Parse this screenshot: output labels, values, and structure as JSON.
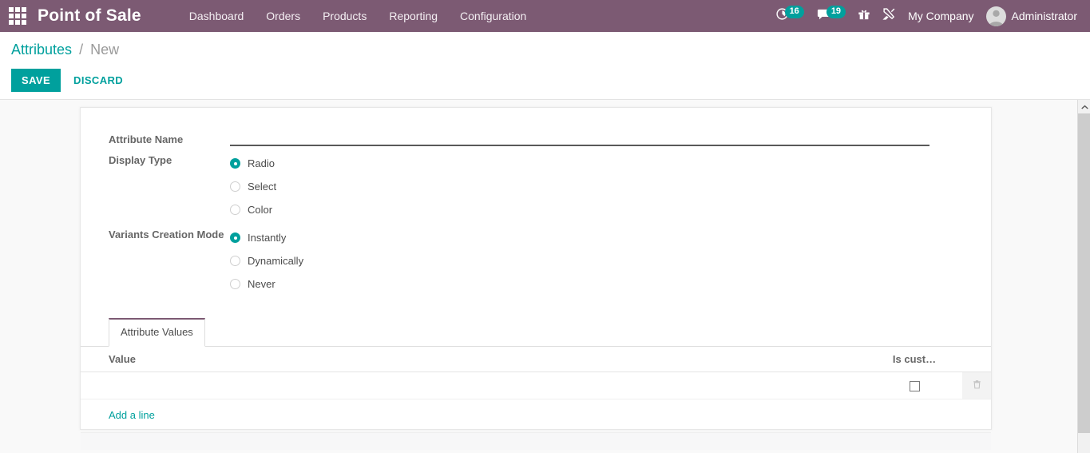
{
  "colors": {
    "navbar": "#7c5a73",
    "accent_teal": "#00a09d",
    "tab_active_border": "#7c5a73",
    "muted_text": "#9a9a9a"
  },
  "navbar": {
    "apps_icon": "apps-grid-icon",
    "brand": "Point of Sale",
    "menu": [
      {
        "label": "Dashboard"
      },
      {
        "label": "Orders"
      },
      {
        "label": "Products"
      },
      {
        "label": "Reporting"
      },
      {
        "label": "Configuration"
      }
    ],
    "systray": {
      "activity_icon": "clock-activity-icon",
      "activity_count": "16",
      "messages_icon": "chat-bubble-icon",
      "messages_count": "19",
      "gift_icon": "gift-icon",
      "tools_icon": "tools-icon",
      "company": "My Company",
      "avatar_icon": "user-avatar-icon",
      "user": "Administrator"
    }
  },
  "control_panel": {
    "breadcrumb": {
      "parent": "Attributes",
      "separator": "/",
      "current": "New"
    },
    "save_label": "SAVE",
    "discard_label": "DISCARD"
  },
  "form": {
    "attribute_name": {
      "label": "Attribute Name",
      "value": "",
      "placeholder": ""
    },
    "display_type": {
      "label": "Display Type",
      "selected": "Radio",
      "options": [
        {
          "label": "Radio",
          "selected": true
        },
        {
          "label": "Select",
          "selected": false
        },
        {
          "label": "Color",
          "selected": false
        }
      ]
    },
    "variants_creation_mode": {
      "label": "Variants Creation Mode",
      "selected": "Instantly",
      "options": [
        {
          "label": "Instantly",
          "selected": true
        },
        {
          "label": "Dynamically",
          "selected": false
        },
        {
          "label": "Never",
          "selected": false
        }
      ]
    }
  },
  "notebook": {
    "tabs": [
      {
        "label": "Attribute Values",
        "active": true
      }
    ],
    "table": {
      "columns": [
        {
          "label": "Value"
        },
        {
          "label": "Is cust…"
        }
      ],
      "rows": [
        {
          "value": "",
          "is_custom_checked": false
        }
      ],
      "trash_icon": "trash-icon",
      "add_line_label": "Add a line"
    }
  },
  "scrollbar": {
    "up_arrow_icon": "chevron-up-icon"
  }
}
